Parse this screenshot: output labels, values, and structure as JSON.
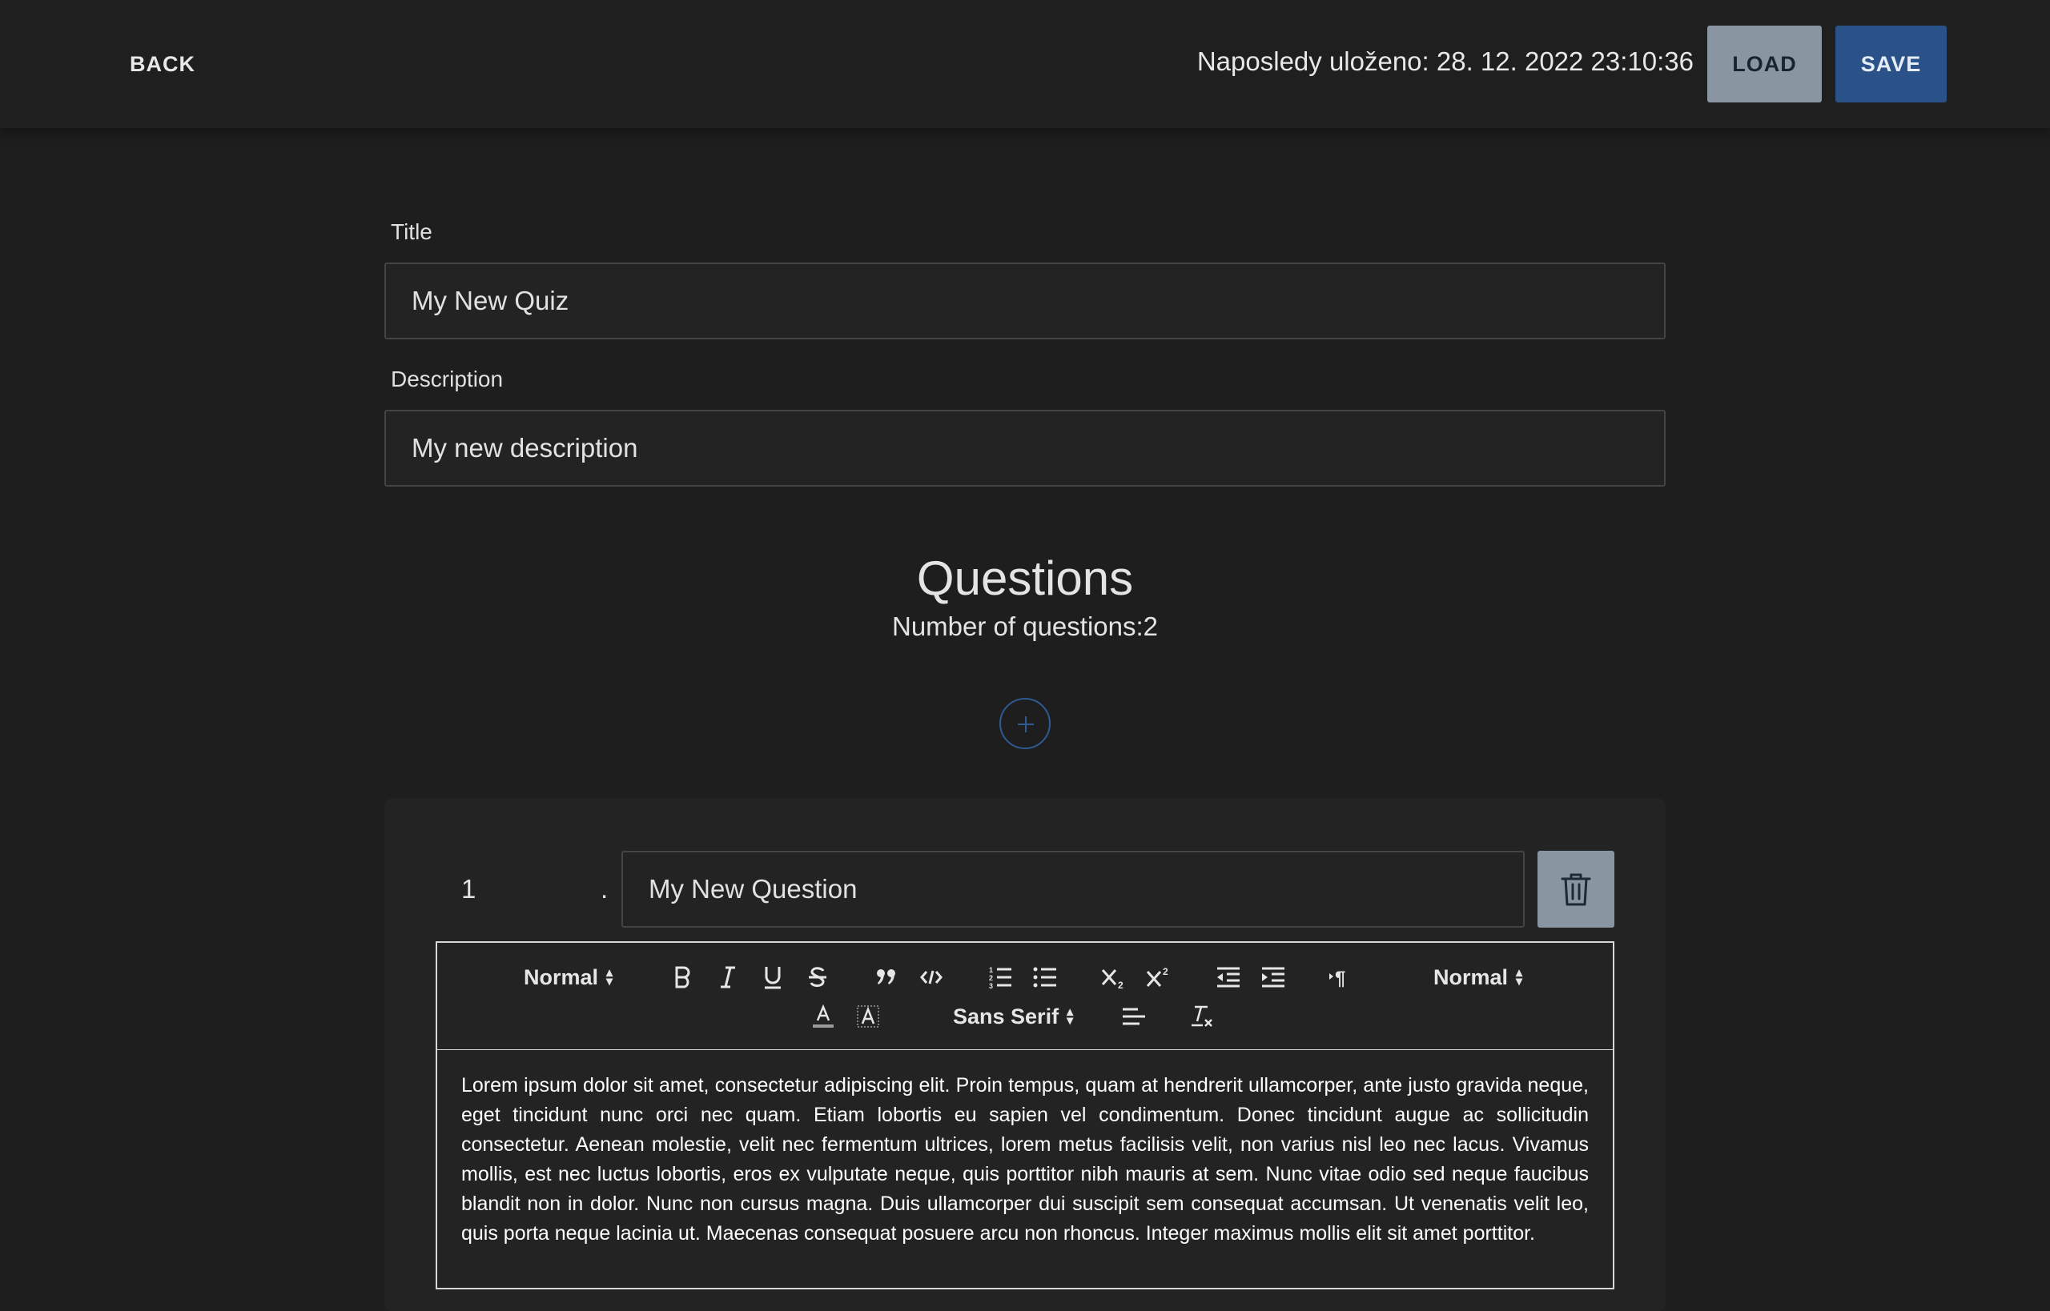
{
  "header": {
    "back_label": "BACK",
    "last_saved": "Naposledy uloženo: 28. 12. 2022 23:10:36",
    "load_label": "LOAD",
    "save_label": "SAVE"
  },
  "form": {
    "title_label": "Title",
    "title_value": "My New Quiz",
    "description_label": "Description",
    "description_value": "My new description"
  },
  "questions": {
    "heading": "Questions",
    "count_text": "Number of questions:2",
    "add_icon": "plus-icon",
    "items": [
      {
        "number": "1",
        "dot": ".",
        "title": "My New Question",
        "delete_icon": "trash-icon",
        "body": "Lorem ipsum dolor sit amet, consectetur adipiscing elit. Proin tempus, quam at hendrerit ullamcorper, ante justo gravida neque, eget tincidunt nunc orci nec quam. Etiam lobortis eu sapien vel condimentum. Donec tincidunt augue ac sollicitudin consectetur. Aenean molestie, velit nec fermentum ultrices, lorem metus facilisis velit, non varius nisl leo nec lacus. Vivamus mollis, est nec luctus lobortis, eros ex vulputate neque, quis porttitor nibh mauris at sem. Nunc vitae odio sed neque faucibus blandit non in dolor. Nunc non cursus magna. Duis ullamcorper dui suscipit sem consequat accumsan. Ut venenatis velit leo, quis porta neque lacinia ut. Maecenas consequat posuere arcu non rhoncus. Integer maximus mollis elit sit amet porttitor."
      }
    ]
  },
  "toolbar": {
    "heading_select": "Normal",
    "size_select": "Normal",
    "font_select": "Sans Serif",
    "icons": [
      "bold-icon",
      "italic-icon",
      "underline-icon",
      "strikethrough-icon",
      "blockquote-icon",
      "code-block-icon",
      "ordered-list-icon",
      "bullet-list-icon",
      "subscript-icon",
      "superscript-icon",
      "outdent-icon",
      "indent-icon",
      "text-direction-icon",
      "text-color-icon",
      "background-color-icon",
      "align-icon",
      "clear-format-icon"
    ]
  },
  "colors": {
    "background": "#1e1e1e",
    "load_button": "#8995a0",
    "save_button": "#2b5288",
    "accent_circle": "#2f5a92"
  }
}
